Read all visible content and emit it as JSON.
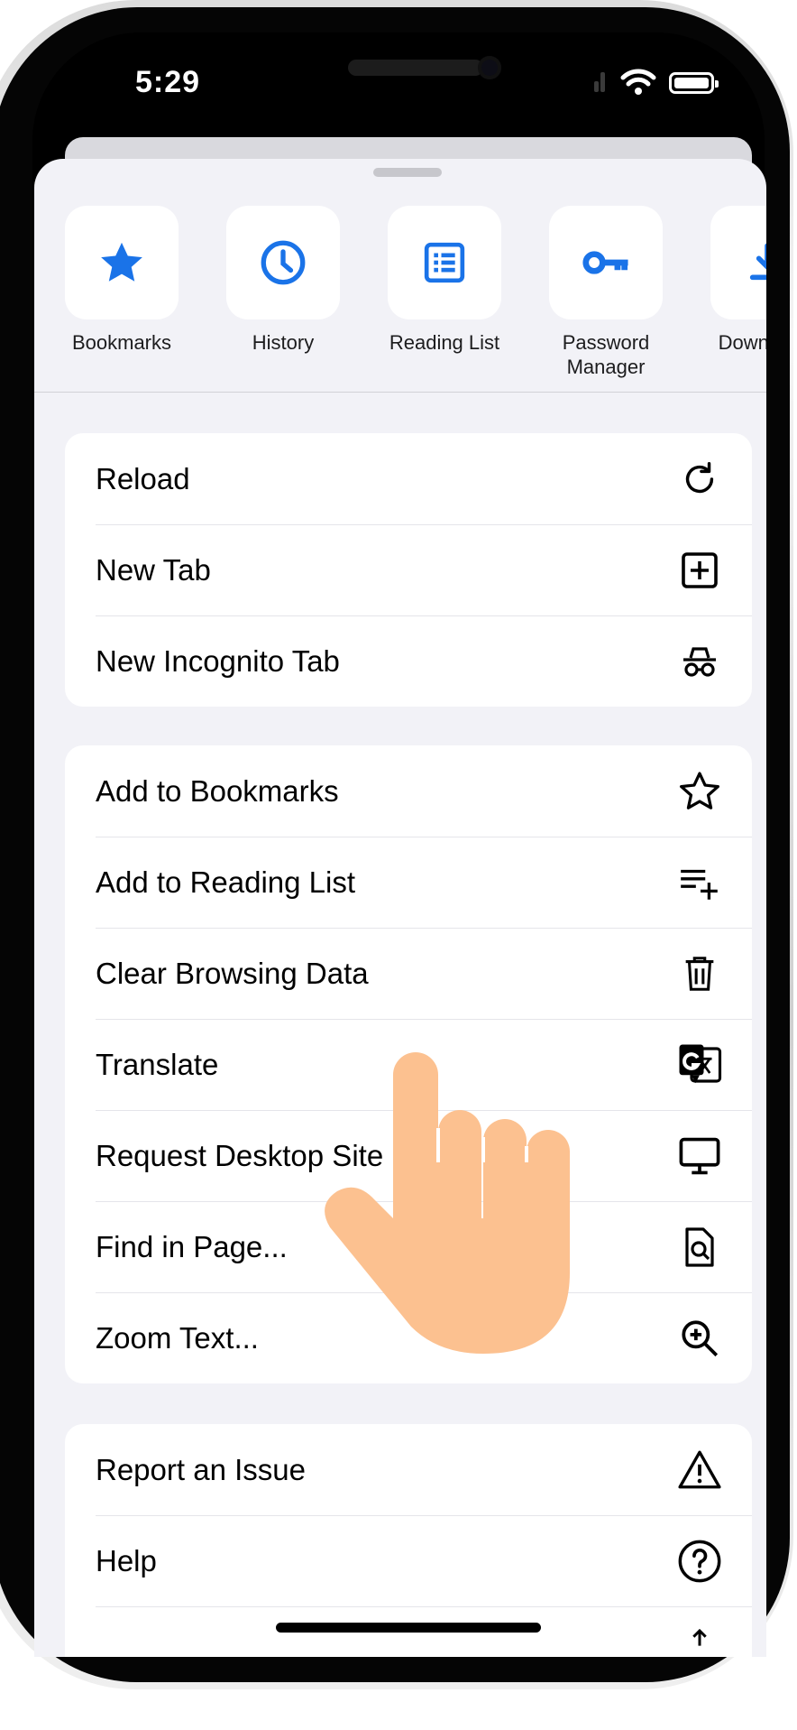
{
  "status_bar": {
    "time": "5:29"
  },
  "quick_tiles": [
    {
      "label": "Bookmarks",
      "icon": "star-icon"
    },
    {
      "label": "History",
      "icon": "clock-icon"
    },
    {
      "label": "Reading List",
      "icon": "list-icon"
    },
    {
      "label": "Password\nManager",
      "icon": "key-icon"
    },
    {
      "label": "Downloads",
      "icon": "download-icon"
    }
  ],
  "menu": {
    "group1": [
      {
        "label": "Reload",
        "icon": "reload-icon"
      },
      {
        "label": "New Tab",
        "icon": "new-tab-icon"
      },
      {
        "label": "New Incognito Tab",
        "icon": "incognito-icon"
      }
    ],
    "group2": [
      {
        "label": "Add to Bookmarks",
        "icon": "star-outline-icon"
      },
      {
        "label": "Add to Reading List",
        "icon": "add-list-icon"
      },
      {
        "label": "Clear Browsing Data",
        "icon": "trash-icon"
      },
      {
        "label": "Translate",
        "icon": "translate-icon"
      },
      {
        "label": "Request Desktop Site",
        "icon": "desktop-icon"
      },
      {
        "label": "Find in Page...",
        "icon": "find-in-page-icon"
      },
      {
        "label": "Zoom Text...",
        "icon": "zoom-in-icon"
      }
    ],
    "group3": [
      {
        "label": "Report an Issue",
        "icon": "warning-icon"
      },
      {
        "label": "Help",
        "icon": "help-icon"
      }
    ]
  },
  "colors": {
    "accent": "#1a73e8",
    "sheet_bg": "#f2f2f7",
    "hand": "#fcc190"
  }
}
